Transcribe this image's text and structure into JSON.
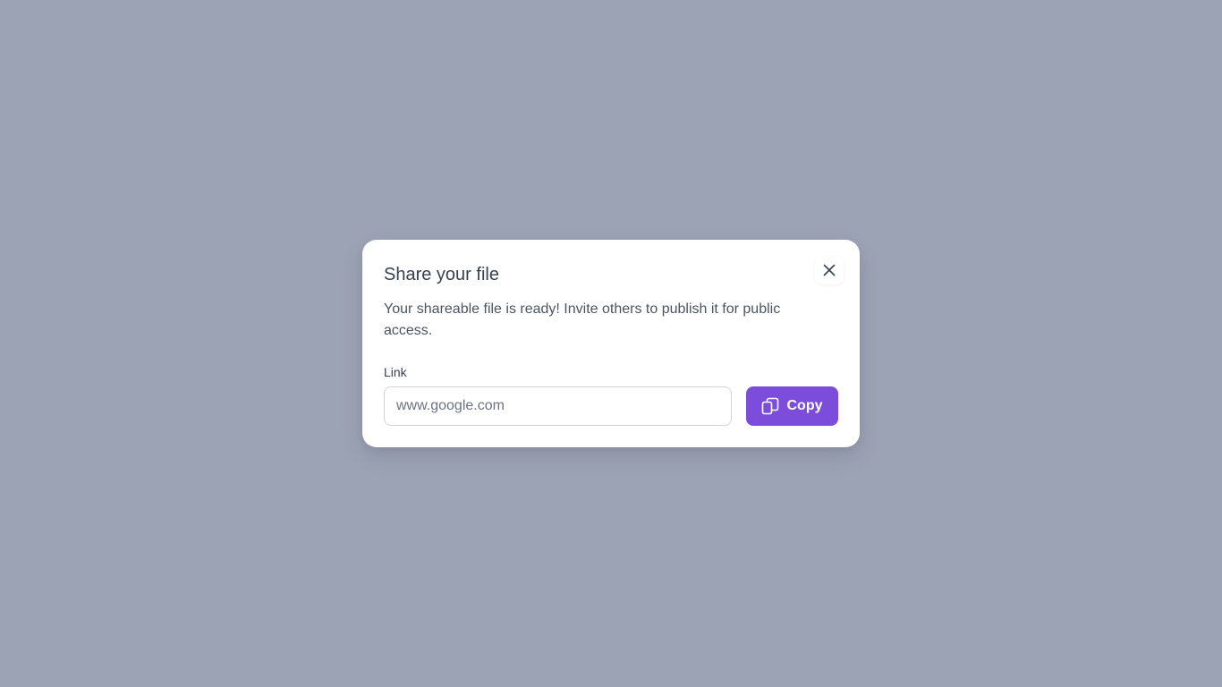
{
  "modal": {
    "title": "Share your file",
    "description": "Your shareable file is ready! Invite others to publish it for public access.",
    "close_icon": "close-icon",
    "link_label": "Link",
    "link_placeholder": "www.google.com",
    "link_value": "",
    "copy_label": "Copy",
    "copy_icon": "copy-icon"
  },
  "colors": {
    "backdrop": "#9ca3b4",
    "accent": "#7c4ddb",
    "surface": "#ffffff",
    "text": "#374151"
  }
}
